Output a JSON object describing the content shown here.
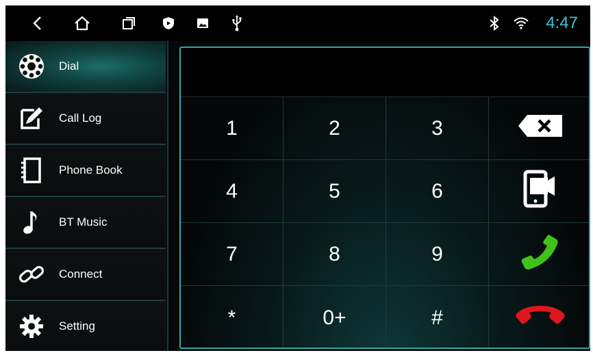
{
  "statusbar": {
    "clock": "4:47",
    "left_icons": [
      "back-icon",
      "home-icon",
      "recent-apps-icon",
      "shield-play-icon",
      "image-icon",
      "usb-icon"
    ],
    "right_icons": [
      "bluetooth-icon",
      "wifi-icon"
    ],
    "clock_color": "#39c6d6"
  },
  "sidebar": {
    "items": [
      {
        "label": "Dial",
        "icon": "dial-icon",
        "active": true
      },
      {
        "label": "Call Log",
        "icon": "call-log-icon",
        "active": false
      },
      {
        "label": "Phone Book",
        "icon": "phone-book-icon",
        "active": false
      },
      {
        "label": "BT Music",
        "icon": "music-note-icon",
        "active": false
      },
      {
        "label": "Connect",
        "icon": "link-icon",
        "active": false
      },
      {
        "label": "Setting",
        "icon": "gear-icon",
        "active": false
      }
    ]
  },
  "dialpad": {
    "number_display": "",
    "keys": [
      [
        "1",
        "2",
        "3"
      ],
      [
        "4",
        "5",
        "6"
      ],
      [
        "7",
        "8",
        "9"
      ],
      [
        "*",
        "0+",
        "#"
      ]
    ],
    "actions": [
      "backspace-icon",
      "phone-transfer-icon",
      "call-icon",
      "hangup-icon"
    ],
    "call_color": "#3ec21a",
    "hangup_color": "#e0161c"
  },
  "accent_color": "#2fa9a6"
}
